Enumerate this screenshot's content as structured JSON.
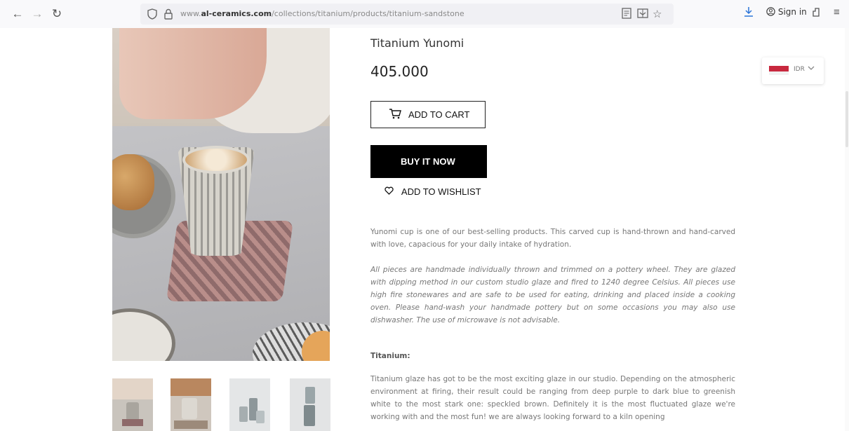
{
  "browser": {
    "url_prefix": "www.",
    "url_domain": "al-ceramics.com",
    "url_path": "/collections/titanium/products/titanium-sandstone",
    "signin_label": "Sign in"
  },
  "product": {
    "title": "Titanium Yunomi",
    "price": "405.000",
    "add_to_cart_label": "ADD TO CART",
    "buy_now_label": "BUY IT NOW",
    "wishlist_label": "ADD TO WISHLIST",
    "description_1": "Yunomi cup is one of our best-selling products. This carved cup is hand-thrown and hand-carved with love, capacious for your daily intake of hydration.",
    "description_2": "All pieces are handmade individually thrown and trimmed on a pottery wheel. They are glazed with dipping method in our custom studio glaze and fired to 1240 degree Celsius. All pieces use high fire stonewares and are safe to be used for eating, drinking and placed inside a cooking oven. Please hand-wash your handmade pottery but on some occasions you may also use dishwasher. The use of microwave is not advisable.",
    "subheading": "Titanium:",
    "description_3": "Titanium glaze has got to be the most exciting glaze in our studio. Depending on the atmospheric environment at firing, their result could be ranging from deep purple to dark blue to greenish white to the most stark one: speckled brown. Definitely it is the most fluctuated glaze we're working with and the most fun! we are always looking forward to a kiln opening"
  },
  "currency": {
    "code": "IDR",
    "flag_colors": [
      "#c8283e",
      "#f1f1f1"
    ]
  },
  "icons": {
    "back": "←",
    "forward": "→",
    "reload": "↻",
    "shield": "🛡",
    "lock": "🔒",
    "reader": "▤",
    "pocket": "⊞",
    "bookmark": "☆",
    "download": "⤓",
    "account": "◉",
    "extensions": "⇱",
    "menu": "≡",
    "cart": "🛒",
    "heart": "♡",
    "chevron": "⌄"
  }
}
